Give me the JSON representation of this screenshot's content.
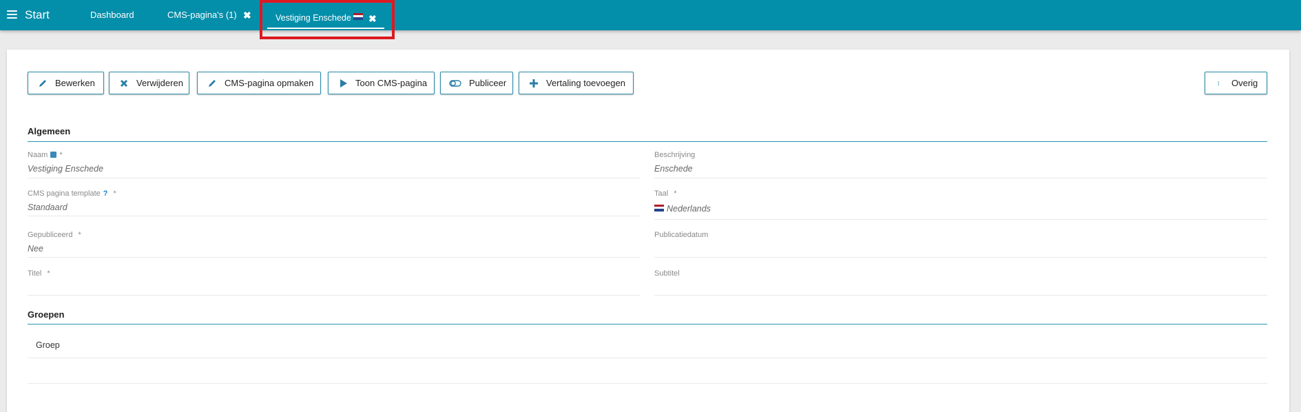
{
  "topbar": {
    "start_label": "Start",
    "tabs": [
      {
        "label": "Dashboard"
      },
      {
        "label": "CMS-pagina's (1)",
        "closable": true
      },
      {
        "label": "Vestiging Enschede",
        "closable": true,
        "active": true
      }
    ],
    "close_glyph": "✖"
  },
  "toolbar": {
    "buttons": [
      {
        "label": "Bewerken",
        "icon": "pencil-icon"
      },
      {
        "label": "Verwijderen",
        "icon": "close-icon"
      },
      {
        "label": "CMS-pagina opmaken",
        "icon": "pencil-icon"
      },
      {
        "label": "Toon CMS-pagina",
        "icon": "play-icon"
      },
      {
        "label": "Publiceer",
        "icon": "toggle-icon"
      },
      {
        "label": "Vertaling toevoegen",
        "icon": "plus-icon"
      }
    ],
    "more_label": "Overig"
  },
  "general": {
    "title": "Algemeen",
    "fields": {
      "naam": {
        "label": "Naam",
        "value": "Vestiging Enschede",
        "required": "*"
      },
      "beschrijving": {
        "label": "Beschrijving",
        "value": "Enschede"
      },
      "template": {
        "label": "CMS pagina template",
        "help": "?",
        "value": "Standaard",
        "required": "*"
      },
      "taal": {
        "label": "Taal",
        "value": "Nederlands",
        "required": "*"
      },
      "gepubliceerd": {
        "label": "Gepubliceerd",
        "value": "Nee",
        "required": "*"
      },
      "publicatiedatum": {
        "label": "Publicatiedatum",
        "value": ""
      },
      "titel": {
        "label": "Titel",
        "value": "",
        "required": "*"
      },
      "subtitel": {
        "label": "Subtitel",
        "value": ""
      }
    }
  },
  "groups": {
    "title": "Groepen",
    "column_header": "Groep"
  },
  "colors": {
    "topbar": "#038eaa",
    "accent": "#2a8ca6",
    "highlight": "#dc1a22"
  }
}
